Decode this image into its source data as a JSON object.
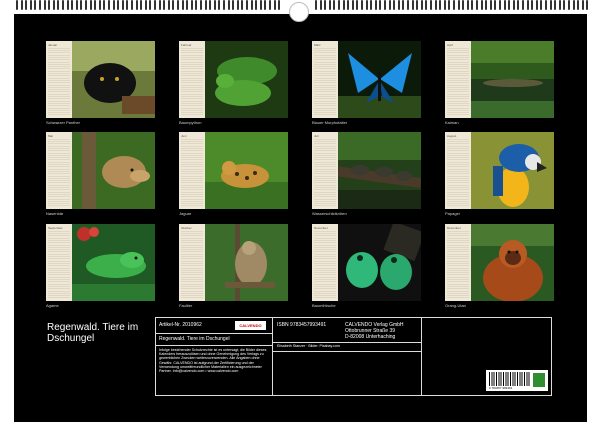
{
  "months": [
    {
      "name": "Januar",
      "caption": "Schwarzer Panther",
      "icon": "panther-photo"
    },
    {
      "name": "Februar",
      "caption": "Baumpython",
      "icon": "python-photo"
    },
    {
      "name": "März",
      "caption": "Blauer Morphofalter",
      "icon": "butterfly-photo"
    },
    {
      "name": "April",
      "caption": "Kaiman",
      "icon": "caiman-photo"
    },
    {
      "name": "Mai",
      "caption": "Nasenbär",
      "icon": "coati-photo"
    },
    {
      "name": "Juni",
      "caption": "Jaguar",
      "icon": "jaguar-photo"
    },
    {
      "name": "Juli",
      "caption": "Wasserschildkröten",
      "icon": "turtles-photo"
    },
    {
      "name": "August",
      "caption": "Papagei",
      "icon": "parrot-photo"
    },
    {
      "name": "September",
      "caption": "Agame",
      "icon": "agama-photo"
    },
    {
      "name": "Oktober",
      "caption": "Faultier",
      "icon": "sloth-photo"
    },
    {
      "name": "November",
      "caption": "Baumfrösche",
      "icon": "treefrog-photo"
    },
    {
      "name": "Dezember",
      "caption": "Orang-Utan",
      "icon": "orangutan-photo"
    }
  ],
  "title": "Regenwald. Tiere im Dschungel",
  "info": {
    "article": "Artikel-Nr. 2010962",
    "logo": "CALVENDO",
    "subtitle": "Regenwald. Tiere im Dschungel",
    "legal": "Infolge bestehender Schutzrechte ist es untersagt, die Bilder dieses Kalenders herauszulösen und ohne Genehmigung des Verlags zu gewerblichen Zwecken weiterzuverwenden. Alle Angaben ohne Gewähr. CALVENDO ist aufgrund der Zertifizierung und der Verwendung umweltfreundlicher Materialien ein ausgezeichneter Partner. Info@calvendo.com • www.calvendo.com",
    "isbn": "ISBN 9783457993491",
    "publisher": [
      "CALVENDO Verlag GmbH",
      "Ottobrunner Straße 39",
      "D-82008 Unterhaching"
    ],
    "credit": "Elisabeth Stanzer · Bilder: Pixabay.com",
    "barcode_number": "9 783457 993491"
  },
  "colors": {
    "background": "#000000",
    "planner": "#efe8d6",
    "text": "#ffffff"
  }
}
